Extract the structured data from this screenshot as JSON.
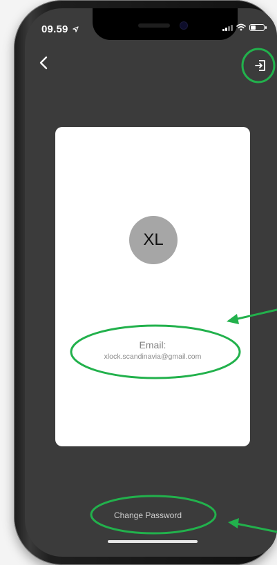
{
  "status_bar": {
    "time": "09.59"
  },
  "navigation": {
    "back_icon": "chevron-left-icon",
    "logout_icon": "logout-icon"
  },
  "profile_card": {
    "avatar_initials": "XL",
    "email_label": "Email:",
    "email_value": "xlock.scandinavia@gmail.com"
  },
  "footer": {
    "change_password_label": "Change Password"
  },
  "colors": {
    "screen_background": "#3b3b3b",
    "card_background": "#ffffff",
    "avatar_background": "#a6a6a6",
    "annotation_green": "#22b14c"
  }
}
